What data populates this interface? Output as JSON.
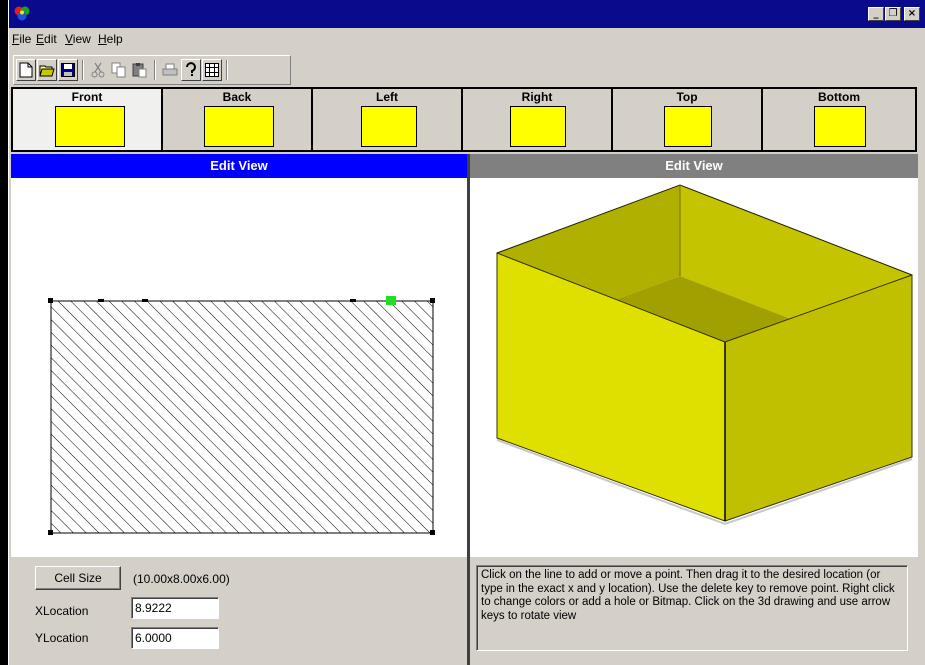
{
  "menu": {
    "file": "File",
    "edit": "Edit",
    "view": "View",
    "help": "Help"
  },
  "window_controls": {
    "minimize": "_",
    "restore": "❐",
    "close": "×"
  },
  "faces": [
    {
      "label": "Front",
      "color": "#ffff00",
      "active": true
    },
    {
      "label": "Back",
      "color": "#ffff00",
      "active": false
    },
    {
      "label": "Left",
      "color": "#ffff00",
      "active": false
    },
    {
      "label": "Right",
      "color": "#ffff00",
      "active": false
    },
    {
      "label": "Top",
      "color": "#ffff00",
      "active": false
    },
    {
      "label": "Bottom",
      "color": "#ffff00",
      "active": false
    }
  ],
  "left_panel": {
    "title": "Edit View",
    "header_color": "#0000ff",
    "selected_point_color": "#22dd22"
  },
  "right_panel": {
    "title": "Edit View",
    "header_color": "#808080",
    "box_color": "#e0e000"
  },
  "cell": {
    "button_label": "Cell Size",
    "dimensions": "(10.00x8.00x6.00)"
  },
  "xlocation": {
    "label": "XLocation",
    "value": "8.9222"
  },
  "ylocation": {
    "label": "YLocation",
    "value": "6.0000"
  },
  "help_text": "Click on the line to add or move a point. Then drag it to the desired location (or type in the exact x and y location). Use the delete key to remove point. Right click to change colors or add a hole or Bitmap. Click on the 3d drawing and use arrow keys to rotate view"
}
